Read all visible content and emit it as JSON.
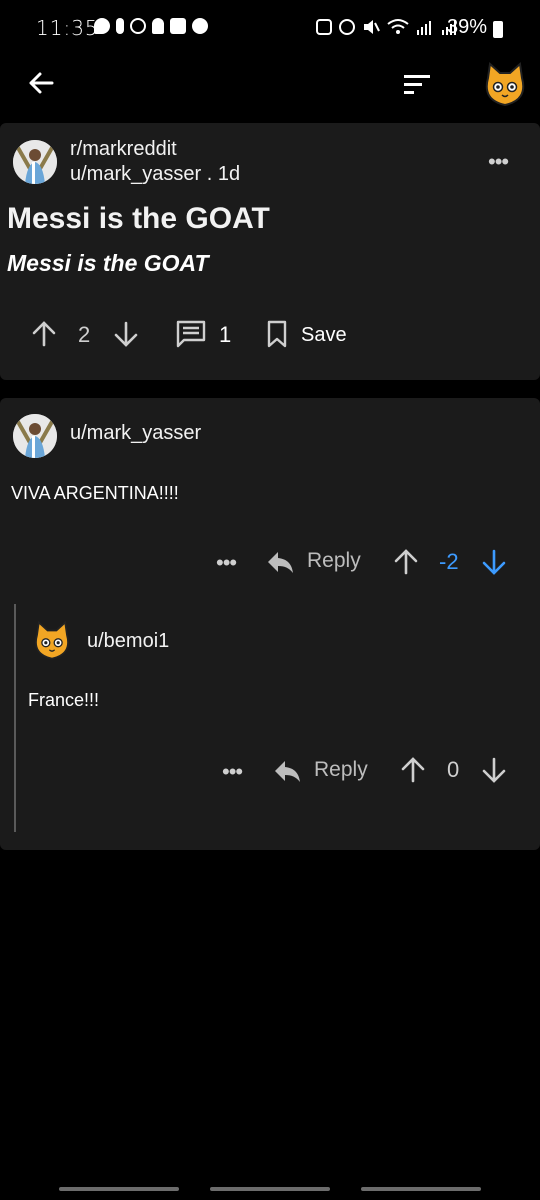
{
  "status_bar": {
    "time": "11:35",
    "battery": "39%"
  },
  "post": {
    "subreddit": "r/markreddit",
    "byline": "u/mark_yasser . 1d",
    "title": "Messi is the GOAT",
    "body": "Messi is the GOAT",
    "score": "2",
    "comments": "1",
    "save_label": "Save"
  },
  "comments": [
    {
      "author": "u/mark_yasser",
      "text": "VIVA ARGENTINA!!!!",
      "reply_label": "Reply",
      "score": "-2",
      "vote_state": "downvoted"
    },
    {
      "author": "u/bemoi1",
      "text": "France!!!",
      "reply_label": "Reply",
      "score": "0",
      "vote_state": "none"
    }
  ],
  "colors": {
    "background": "#000000",
    "card": "#1b1b1b",
    "downvote_active": "#3d9bff"
  },
  "icons": [
    "back-arrow-icon",
    "sort-icon",
    "cat-avatar-icon",
    "upvote-icon",
    "downvote-icon",
    "comment-icon",
    "bookmark-icon",
    "reply-icon",
    "more-icon"
  ]
}
